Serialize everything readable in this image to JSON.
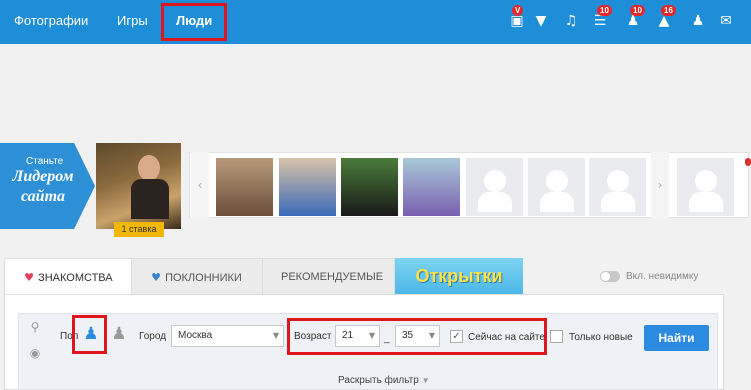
{
  "nav": {
    "items": [
      {
        "label": "Фотографии"
      },
      {
        "label": "Игры"
      },
      {
        "label": "Люди"
      }
    ]
  },
  "toolbar": {
    "icons": [
      "gift-icon",
      "diamond-icon",
      "music-icon",
      "list-icon",
      "user-friends-icon",
      "bell-icon",
      "mail-icon"
    ],
    "badges": {
      "gift": "V",
      "list": "10",
      "friends": "10",
      "bell": "16"
    }
  },
  "leader": {
    "small": "Станьте",
    "big": "Лидером сайта",
    "stake": "1 ставка"
  },
  "tabs": {
    "dating": "ЗНАКОМСТВА",
    "fans": "ПОКЛОННИКИ",
    "recommended": "РЕКОМЕНДУЕМЫЕ",
    "cards": "Открытки",
    "invisible": "Вкл. невидимку"
  },
  "filter": {
    "gender_label": "Пол",
    "city_label": "Город",
    "city_value": "Москва",
    "age_label": "Возраст",
    "age_from": "21",
    "age_sep": "_",
    "age_to": "35",
    "online_label": "Сейчас на сайте",
    "new_label": "Только новые",
    "find_button": "Найти",
    "expand": "Раскрыть фильтр"
  },
  "colors": {
    "accent": "#1f8ed8",
    "highlight": "#e0161d",
    "badge": "#e8262b"
  }
}
